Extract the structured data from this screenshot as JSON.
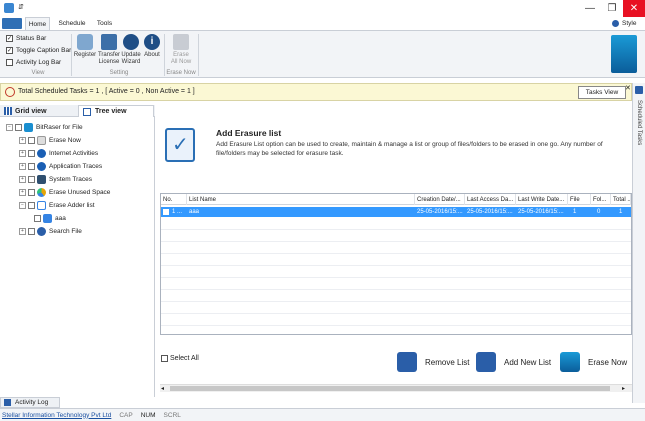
{
  "window": {
    "title": "",
    "quick_access_glyph": "⇵",
    "minimize_glyph": "—",
    "restore_glyph": "❐",
    "close_glyph": "✕"
  },
  "ribbon": {
    "tabs": [
      "Home",
      "Schedule",
      "Tools"
    ],
    "style_label": "Style",
    "view_group": {
      "label": "View",
      "checkboxes": [
        {
          "label": "Status Bar",
          "checked": true
        },
        {
          "label": "Toggle Caption Bar",
          "checked": true
        },
        {
          "label": "Activity Log Bar",
          "checked": false
        }
      ]
    },
    "setting_group": {
      "label": "Setting",
      "buttons": [
        {
          "label": "Register",
          "icon": "key-icon"
        },
        {
          "label": "Transfer\nLicense",
          "icon": "transfer-icon"
        },
        {
          "label": "Update\nWizard",
          "icon": "globe-icon"
        },
        {
          "label": "About",
          "icon": "info-icon"
        }
      ]
    },
    "erase_group": {
      "label": "Erase Now",
      "button_label": "Erase\nAll Now"
    }
  },
  "notification": {
    "text": "Total Scheduled Tasks = 1 , [ Active  = 0 , Non Active = 1 ]",
    "button_label": "Tasks View",
    "close_glyph": "✕"
  },
  "side_panel": {
    "label": "Scheduled Tasks"
  },
  "view_tabs": {
    "grid": "Grid view",
    "tree": "Tree view"
  },
  "tree": {
    "root": "BitRaser for File",
    "items": [
      {
        "label": "Erase Now",
        "icon_color": "#ffffff"
      },
      {
        "label": "Internet Activities",
        "icon_color": "#1a5fb4"
      },
      {
        "label": "Application Traces",
        "icon_color": "#1a5fb4"
      },
      {
        "label": "System Traces",
        "icon_color": "#2f4f6f"
      },
      {
        "label": "Erase Unused Space",
        "icon_color": "#e5a50a"
      },
      {
        "label": "Erase Adder list",
        "icon_color": "#3584e4"
      }
    ],
    "child": "aaa",
    "last": "Search File"
  },
  "content": {
    "title": "Add Erasure list",
    "description": "Add Erasure List option can be used to create, maintain & manage a list or group of files/folders to be erased in one go. Any number of file/folders may be selected for erasure task."
  },
  "grid": {
    "columns": [
      "No.",
      "List Name",
      "Creation Date/...",
      "Last Access Da...",
      "Last Write Date...",
      "File",
      "Fol...",
      "Total ..."
    ],
    "rows": [
      [
        "1 ...",
        "aaa",
        "25-05-2016/15:...",
        "25-05-2016/15:...",
        "25-05-2016/15:...",
        "1",
        "0",
        "1"
      ]
    ]
  },
  "actions": {
    "select_all": "Select All",
    "remove": "Remove List",
    "add_new": "Add New List",
    "erase_now": "Erase Now"
  },
  "activity_log": "Activity Log",
  "statusbar": {
    "company": "Stellar Information Technology Pvt Ltd",
    "indicators": [
      "CAP",
      "NUM",
      "SCRL"
    ]
  },
  "colors": {
    "accent": "#3399ff",
    "ribbon_bg": "#f2f4f7",
    "notify_bg": "#fbf8d4",
    "close_red": "#e81123"
  }
}
